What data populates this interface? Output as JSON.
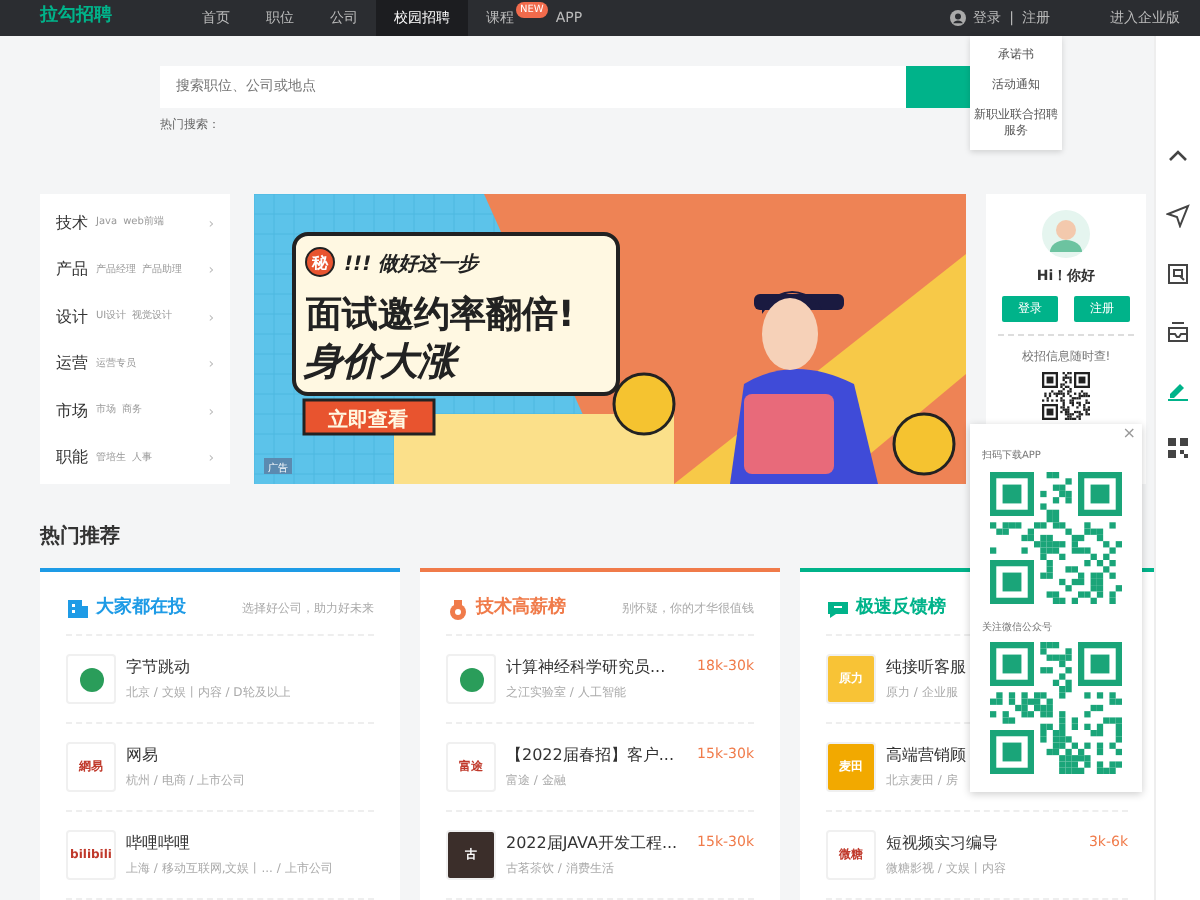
{
  "topbar": {
    "logo": "拉勾招聘",
    "nav": [
      {
        "label": "首页",
        "selected": false
      },
      {
        "label": "职位",
        "selected": false
      },
      {
        "label": "公司",
        "selected": false
      },
      {
        "label": "校园招聘",
        "selected": true
      },
      {
        "label": "课程",
        "selected": false,
        "badge": "NEW"
      },
      {
        "label": "APP",
        "selected": false
      }
    ],
    "login": "登录",
    "separator": "|",
    "register": "注册",
    "enterprise": "进入企业版"
  },
  "dropdown": {
    "items": [
      "承诺书",
      "活动通知",
      "新职业联合招聘服务"
    ]
  },
  "search": {
    "placeholder": "搜索职位、公司或地点",
    "hot_label": "热门搜索："
  },
  "categories": [
    {
      "title": "技术",
      "tags": [
        "Java",
        "web前端"
      ],
      "arrow": "›"
    },
    {
      "title": "产品",
      "tags": [
        "产品经理",
        "产品助理"
      ],
      "arrow": "›"
    },
    {
      "title": "设计",
      "tags": [
        "UI设计",
        "视觉设计"
      ],
      "arrow": "›"
    },
    {
      "title": "运营",
      "tags": [
        "运营专员"
      ],
      "arrow": "›"
    },
    {
      "title": "市场",
      "tags": [
        "市场",
        "商务"
      ],
      "arrow": "›"
    },
    {
      "title": "职能",
      "tags": [
        "管培生",
        "人事"
      ],
      "arrow": "›"
    }
  ],
  "banner": {
    "badge": "秘",
    "kicker": "!!!  做好这一步",
    "headline_1": "面试邀约率翻倍!",
    "headline_2": "身价大涨",
    "cta": "立即查看",
    "ad_tag": "广告"
  },
  "user_panel": {
    "greeting": "Hi！你好",
    "login": "登录",
    "register": "注册",
    "qr_caption": "校招信息随时查!"
  },
  "qr_popup": {
    "close": "×",
    "app_caption": "扫码下载APP",
    "wechat_caption": "关注微信公众号"
  },
  "sidebar": {
    "items": [
      {
        "selected": false
      },
      {
        "selected": false
      },
      {
        "selected": false
      },
      {
        "selected": false
      },
      {
        "selected": true
      },
      {
        "selected": false
      }
    ]
  },
  "section_title": "热门推荐",
  "cards": [
    {
      "title": "大家都在投",
      "subtitle": "选择好公司，助力好未来",
      "color": "#1e9be6",
      "rows": [
        {
          "name": "字节跳动",
          "meta": "北京 / 文娱丨内容 / D轮及以上",
          "logo": "",
          "color": "#ffffff"
        },
        {
          "name": "网易",
          "meta": "杭州 / 电商 / 上市公司",
          "logo": "網易",
          "color": "#ffffff"
        },
        {
          "name": "哔哩哔哩",
          "meta": "上海 / 移动互联网,文娱丨... / 上市公司",
          "logo": "bilibili",
          "color": "#ffffff"
        }
      ]
    },
    {
      "title": "技术高薪榜",
      "subtitle": "别怀疑，你的才华很值钱",
      "color": "#f07b4a",
      "rows": [
        {
          "name": "计算神经科学研究员...",
          "meta": "之江实验室 / 人工智能",
          "salary": "18k-30k",
          "logo": "",
          "color": "#ffffff"
        },
        {
          "name": "【2022届春招】客户...",
          "meta": "富途 / 金融",
          "salary": "15k-30k",
          "logo": "富途",
          "color": "#ffffff"
        },
        {
          "name": "2022届JAVA开发工程...",
          "meta": "古茗茶饮 / 消费生活",
          "salary": "15k-30k",
          "logo": "古",
          "color": "#3b2e2a"
        }
      ]
    },
    {
      "title": "极速反馈榜",
      "color": "#00b38a",
      "rows": [
        {
          "name": "纯接听客服",
          "meta": "原力 / 企业服",
          "logo": "原力",
          "color": "#f8c336"
        },
        {
          "name": "高端营销顾",
          "meta": "北京麦田 / 房",
          "logo": "麦田",
          "color": "#f2a900"
        },
        {
          "name": "短视频实习编导",
          "meta": "微糖影视 / 文娱丨内容",
          "salary": "3k-6k",
          "logo": "微糖",
          "color": "#ffffff"
        }
      ]
    }
  ]
}
